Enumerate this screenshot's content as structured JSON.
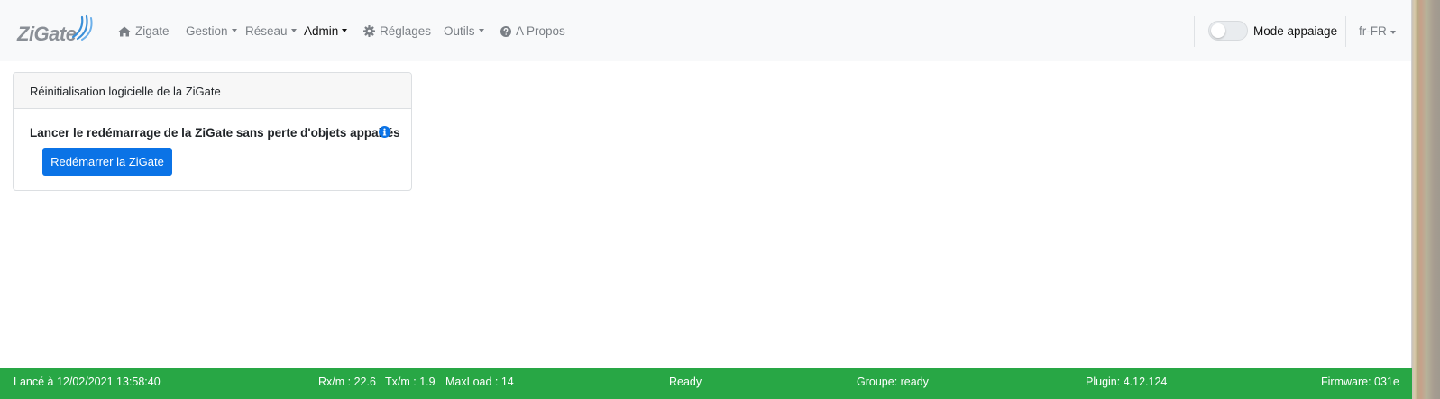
{
  "navbar": {
    "brand": "ZiGate",
    "items": [
      {
        "label": "Zigate",
        "icon": "home-icon",
        "caret": false
      },
      {
        "label": "Gestion",
        "icon": "",
        "caret": true
      },
      {
        "label": "Réseau",
        "icon": "",
        "caret": true
      },
      {
        "label": "Admin",
        "icon": "",
        "caret": true,
        "active": true
      },
      {
        "label": "Réglages",
        "icon": "gear-icon",
        "caret": false
      },
      {
        "label": "Outils",
        "icon": "",
        "caret": true
      },
      {
        "label": "A Propos",
        "icon": "question-circle-icon",
        "caret": false
      }
    ],
    "pairing_toggle": {
      "label": "Mode appaiage",
      "on": false
    },
    "language": "fr-FR"
  },
  "card": {
    "header": "Réinitialisation logicielle de la ZiGate",
    "description": "Lancer le redémarrage de la ZiGate sans perte d'objets appairés",
    "button": "Redémarrer la ZiGate"
  },
  "footer": {
    "started": "Lancé à 12/02/2021 13:58:40",
    "rx": "Rx/m : 22.6",
    "tx": "Tx/m : 1.9",
    "maxload": "MaxLoad : 14",
    "status": "Ready",
    "group": "Groupe: ready",
    "plugin": "Plugin: 4.12.124",
    "firmware": "Firmware: 031e"
  },
  "colors": {
    "navbar_bg": "#f8f9fa",
    "primary": "#0b73e6",
    "footer_bg": "#28a745"
  }
}
